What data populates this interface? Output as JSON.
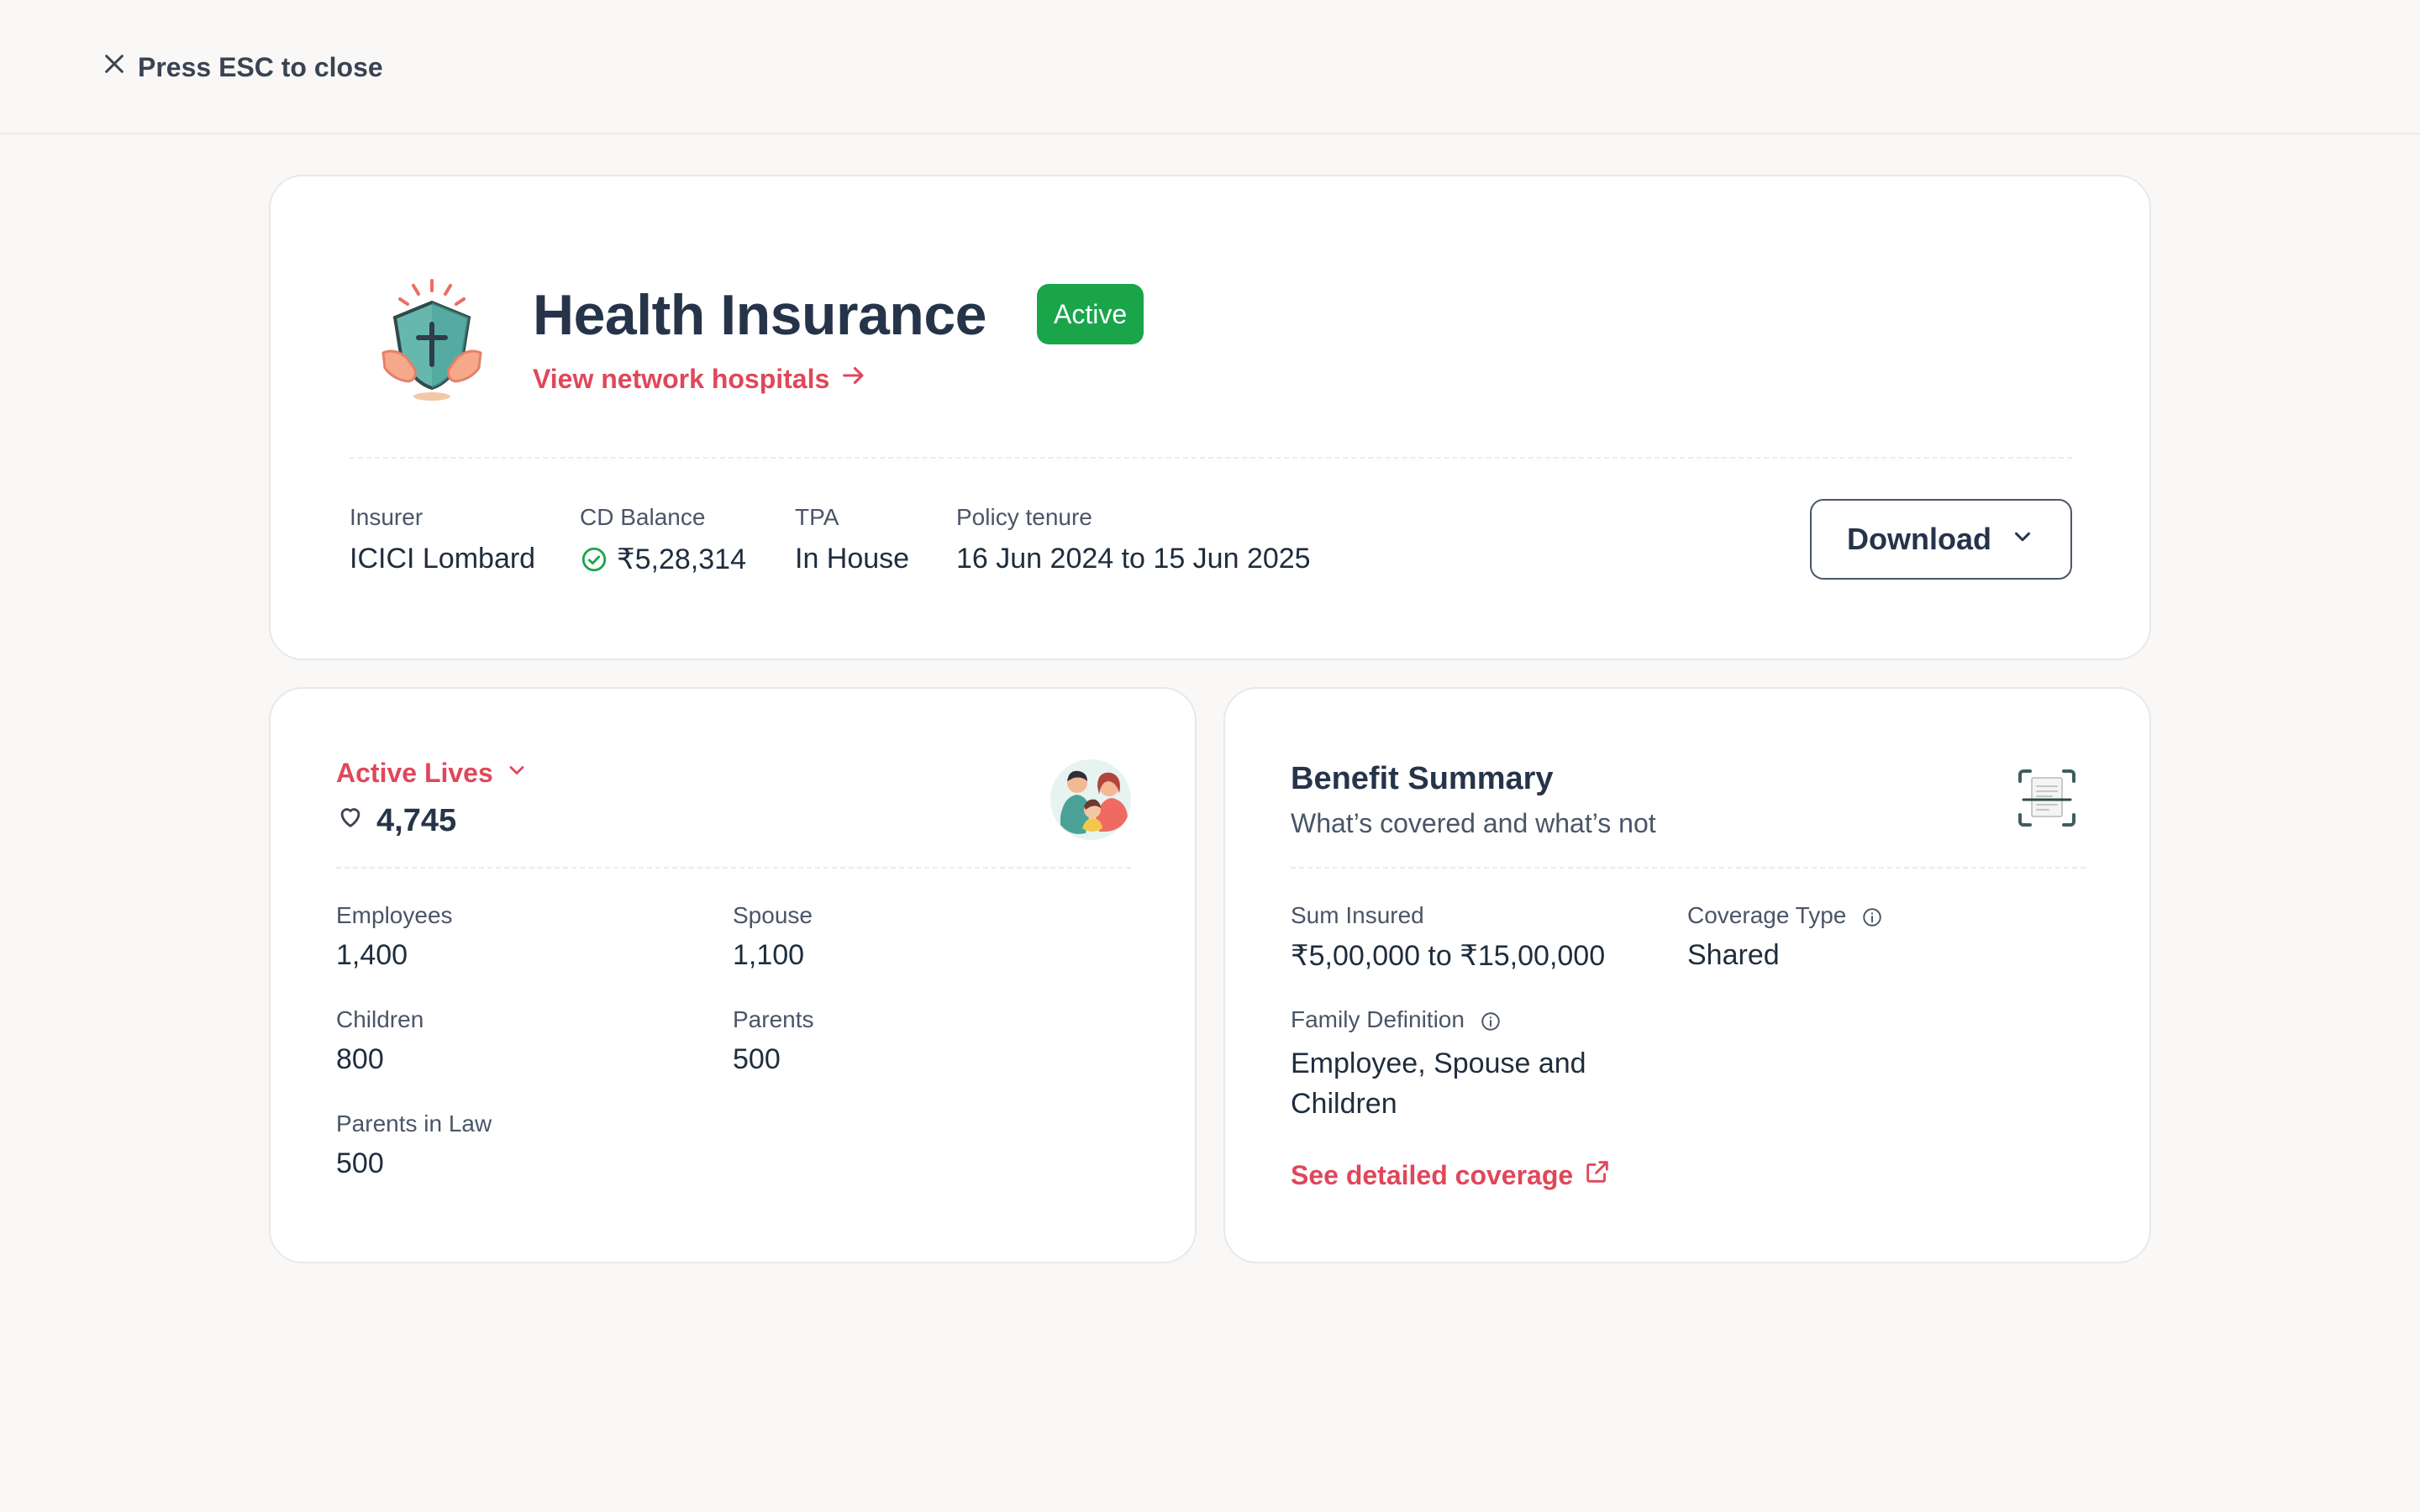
{
  "header": {
    "close_label": "Press ESC to close"
  },
  "policy": {
    "title": "Health Insurance",
    "status": "Active",
    "hospitals_link": "View network hospitals",
    "meta": {
      "insurer_label": "Insurer",
      "insurer_value": "ICICI Lombard",
      "cd_label": "CD Balance",
      "cd_value": "₹5,28,314",
      "tpa_label": "TPA",
      "tpa_value": "In House",
      "tenure_label": "Policy tenure",
      "tenure_value": "16 Jun 2024 to 15 Jun 2025"
    },
    "download_label": "Download"
  },
  "lives": {
    "toggle_label": "Active Lives",
    "count": "4,745",
    "stats": [
      {
        "label": "Employees",
        "value": "1,400"
      },
      {
        "label": "Spouse",
        "value": "1,100"
      },
      {
        "label": "Children",
        "value": "800"
      },
      {
        "label": "Parents",
        "value": "500"
      },
      {
        "label": "Parents in Law",
        "value": "500"
      }
    ]
  },
  "benefit": {
    "title": "Benefit Summary",
    "subtitle": "What’s covered and what’s not",
    "sum_insured_label": "Sum Insured",
    "sum_insured_value": "₹5,00,000 to ₹15,00,000",
    "coverage_type_label": "Coverage Type",
    "coverage_type_value": "Shared",
    "family_def_label": "Family Definition",
    "family_def_value": "Employee, Spouse and Children",
    "coverage_link": "See detailed coverage"
  },
  "colors": {
    "accent_red": "#e0475a",
    "active_green": "#1aa54b",
    "title_navy": "#26344a"
  },
  "icons": [
    "close-icon",
    "shield-hands-icon",
    "arrow-right-icon",
    "check-circle-icon",
    "chevron-down-icon",
    "heart-icon",
    "family-icon",
    "document-scan-icon",
    "info-icon",
    "external-link-icon"
  ]
}
